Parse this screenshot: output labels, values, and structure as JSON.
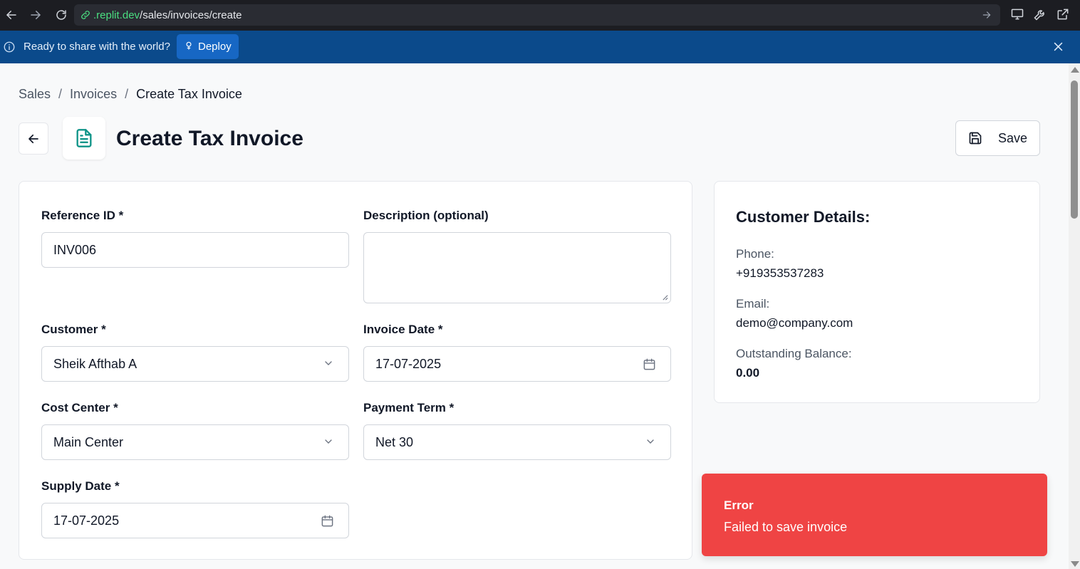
{
  "browser": {
    "url_host": ".replit.dev",
    "url_path": "/sales/invoices/create"
  },
  "banner": {
    "text": "Ready to share with the world?",
    "deploy_label": "Deploy"
  },
  "breadcrumb": {
    "items": [
      "Sales",
      "Invoices",
      "Create Tax Invoice"
    ],
    "separator": "/"
  },
  "header": {
    "title": "Create Tax Invoice",
    "save_label": "Save"
  },
  "form": {
    "reference_id": {
      "label": "Reference ID *",
      "value": "INV006"
    },
    "description": {
      "label": "Description (optional)",
      "value": ""
    },
    "customer": {
      "label": "Customer *",
      "value": "Sheik Afthab A"
    },
    "invoice_date": {
      "label": "Invoice Date *",
      "value": "17-07-2025"
    },
    "cost_center": {
      "label": "Cost Center *",
      "value": "Main Center"
    },
    "payment_term": {
      "label": "Payment Term *",
      "value": "Net 30"
    },
    "supply_date": {
      "label": "Supply Date *",
      "value": "17-07-2025"
    }
  },
  "customer_details": {
    "title": "Customer Details:",
    "phone_label": "Phone:",
    "phone": "+919353537283",
    "email_label": "Email:",
    "email": "demo@company.com",
    "balance_label": "Outstanding Balance:",
    "balance": "0.00"
  },
  "toast": {
    "title": "Error",
    "message": "Failed to save invoice"
  },
  "colors": {
    "accent_teal": "#0f9488",
    "banner_bg": "#0b4a8b",
    "deploy_bg": "#1767c4",
    "error_bg": "#ef4444"
  }
}
